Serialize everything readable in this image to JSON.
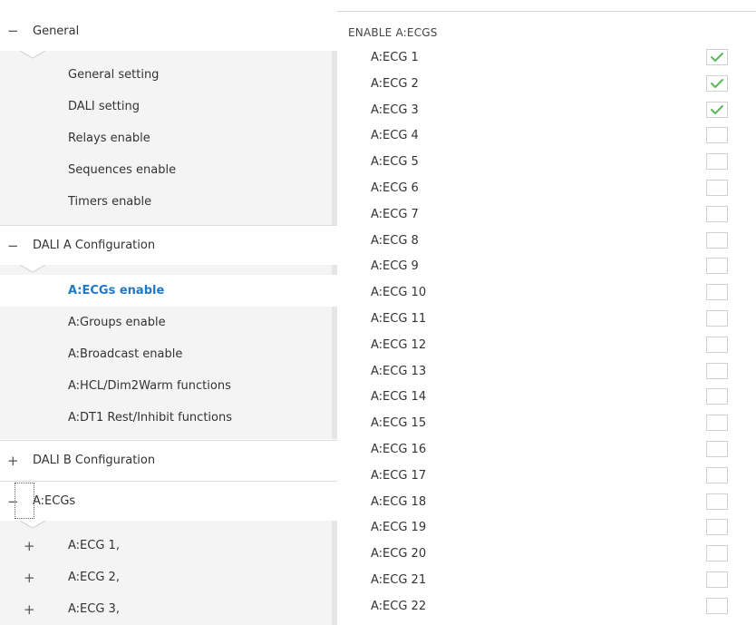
{
  "tree": {
    "general": {
      "expander": "−",
      "label": "General",
      "items": [
        "General setting",
        "DALI setting",
        "Relays enable",
        "Sequences enable",
        "Timers enable"
      ]
    },
    "dali_a": {
      "expander": "−",
      "label": "DALI A Configuration",
      "items": [
        "A:ECGs enable",
        "A:Groups enable",
        "A:Broadcast enable",
        "A:HCL/Dim2Warm functions",
        "A:DT1 Rest/Inhibit functions"
      ],
      "active_item": "A:ECGs enable"
    },
    "dali_b": {
      "expander": "+",
      "label": "DALI B Configuration"
    },
    "a_ecgs": {
      "expander": "−",
      "label": "A:ECGs",
      "children": [
        {
          "expander": "+",
          "label": "A:ECG 1,"
        },
        {
          "expander": "+",
          "label": "A:ECG 2,"
        },
        {
          "expander": "+",
          "label": "A:ECG 3,"
        }
      ]
    }
  },
  "content": {
    "title": "ENABLE A:ECGS",
    "ecgs": [
      {
        "label": "A:ECG 1",
        "checked": true
      },
      {
        "label": "A:ECG 2",
        "checked": true
      },
      {
        "label": "A:ECG 3",
        "checked": true
      },
      {
        "label": "A:ECG 4",
        "checked": false
      },
      {
        "label": "A:ECG 5",
        "checked": false
      },
      {
        "label": "A:ECG 6",
        "checked": false
      },
      {
        "label": "A:ECG 7",
        "checked": false
      },
      {
        "label": "A:ECG 8",
        "checked": false
      },
      {
        "label": "A:ECG 9",
        "checked": false
      },
      {
        "label": "A:ECG 10",
        "checked": false
      },
      {
        "label": "A:ECG 11",
        "checked": false
      },
      {
        "label": "A:ECG 12",
        "checked": false
      },
      {
        "label": "A:ECG 13",
        "checked": false
      },
      {
        "label": "A:ECG 14",
        "checked": false
      },
      {
        "label": "A:ECG 15",
        "checked": false
      },
      {
        "label": "A:ECG 16",
        "checked": false
      },
      {
        "label": "A:ECG 17",
        "checked": false
      },
      {
        "label": "A:ECG 18",
        "checked": false
      },
      {
        "label": "A:ECG 19",
        "checked": false
      },
      {
        "label": "A:ECG 20",
        "checked": false
      },
      {
        "label": "A:ECG 21",
        "checked": false
      },
      {
        "label": "A:ECG 22",
        "checked": false
      }
    ]
  },
  "colors": {
    "accent": "#1f79c7",
    "check": "#5cb85c",
    "sub_background": "#f4f4f4",
    "divider": "#dcdcdc"
  },
  "icons": {
    "collapse": "minus-icon",
    "expand": "plus-icon",
    "checked": "checkmark-icon"
  }
}
